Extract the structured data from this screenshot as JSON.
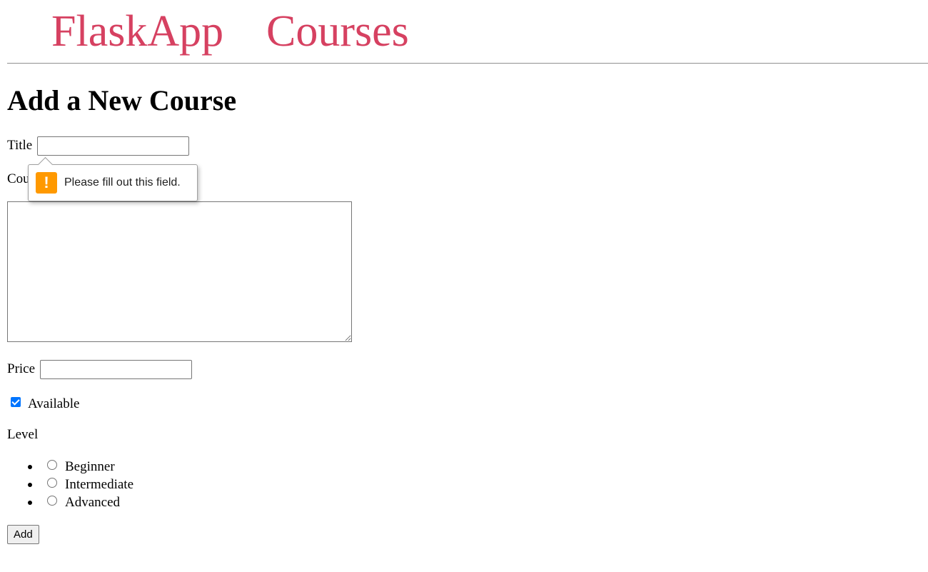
{
  "nav": {
    "brand": "FlaskApp",
    "courses_link": "Courses",
    "link_color": "#d64161"
  },
  "page": {
    "heading": "Add a New Course"
  },
  "form": {
    "title_label": "Title",
    "title_value": "",
    "course_description_label": "Cou",
    "description_value": "",
    "price_label": "Price",
    "price_value": "",
    "available_label": "Available",
    "available_checked": true,
    "level_label": "Level",
    "level_options": [
      "Beginner",
      "Intermediate",
      "Advanced"
    ],
    "submit_label": "Add"
  },
  "validation_tooltip": {
    "message": "Please fill out this field.",
    "icon": "warning-icon",
    "icon_glyph": "!",
    "icon_color": "#ff9900"
  }
}
